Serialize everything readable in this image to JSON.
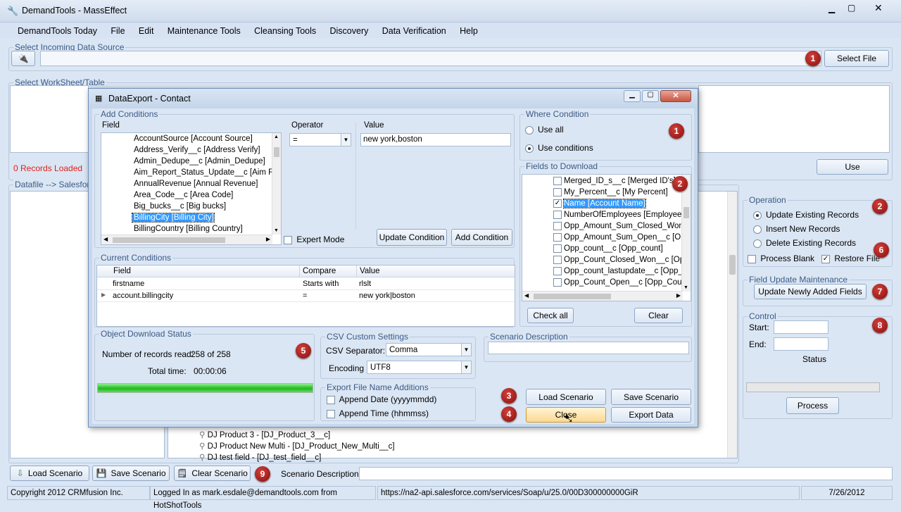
{
  "app": {
    "title": "DemandTools - MassEffect"
  },
  "menu": [
    "DemandTools Today",
    "File",
    "Edit",
    "Maintenance Tools",
    "Cleansing Tools",
    "Discovery",
    "Data Verification",
    "Help"
  ],
  "source": {
    "group_label": "Select Incoming Data Source",
    "select_file": "Select File"
  },
  "worksheet": {
    "group_label": "Select WorkSheet/Table"
  },
  "records_loaded": "0 Records Loaded",
  "use_button": "Use",
  "mapping_label": "Datafile --> Salesforce",
  "operation": {
    "label": "Operation",
    "options": [
      "Update Existing Records",
      "Insert New Records",
      "Delete Existing Records"
    ],
    "process_blank": "Process Blank",
    "restore_file": "Restore File"
  },
  "field_update": {
    "label": "Field Update Maintenance",
    "button": "Update Newly Added Fields"
  },
  "control": {
    "label": "Control",
    "start": "Start:",
    "end": "End:",
    "status": "Status",
    "process": "Process"
  },
  "bg_tree": [
    "DJ Product 3 - [DJ_Product_3__c]",
    "DJ Product New Multi - [DJ_Product_New_Multi__c]",
    "DJ test field - [DJ_test_field__c]"
  ],
  "bottom": {
    "load": "Load Scenario",
    "save": "Save Scenario",
    "clear": "Clear Scenario",
    "desc_label": "Scenario Description:"
  },
  "statusbar": {
    "copyright": "Copyright 2012 CRMfusion Inc.",
    "login": "Logged In as mark.esdale@demandtools.com from HotShotTools",
    "url": "https://na2-api.salesforce.com/services/Soap/u/25.0/00D300000000GiR",
    "date": "7/26/2012"
  },
  "badges": [
    "1",
    "1",
    "2",
    "2",
    "3",
    "4",
    "5",
    "6",
    "7",
    "8",
    "9"
  ],
  "dialog": {
    "title": "DataExport - Contact",
    "add_conditions": "Add Conditions",
    "field_header": "Field",
    "operator_header": "Operator",
    "value_header": "Value",
    "operator_value": "=",
    "value_input": "new york,boston",
    "fields": [
      "AccountSource [Account Source]",
      "Address_Verify__c [Address Verify]",
      "Admin_Dedupe__c [Admin_Dedupe]",
      "Aim_Report_Status_Update__c [Aim Rep",
      "AnnualRevenue [Annual Revenue]",
      "Area_Code__c [Area Code]",
      "Big_bucks__c [Big bucks]",
      "BillingCity [Billing City]",
      "BillingCountry [Billing Country]"
    ],
    "expert_mode": "Expert Mode",
    "update_condition": "Update Condition",
    "add_condition": "Add Condition",
    "where_condition": "Where Condition",
    "use_all": "Use all",
    "use_conditions": "Use conditions",
    "fields_to_download": "Fields to Download",
    "download_fields": [
      "Merged_ID_s__c [Merged ID's]",
      "My_Percent__c [My Percent]",
      "Name [Account Name]",
      "NumberOfEmployees [Employees]",
      "Opp_Amount_Sum_Closed_Won__",
      "Opp_Amount_Sum_Open__c [Opp_",
      "Opp_count__c [Opp_count]",
      "Opp_Count_Closed_Won__c [Opp_",
      "Opp_count_lastupdate__c [Opp_co",
      "Opp_Count_Open__c [Opp_Count_"
    ],
    "check_all": "Check all",
    "clear": "Clear",
    "current_conditions": "Current Conditions",
    "cond_columns": [
      "Field",
      "Compare",
      "Value"
    ],
    "conditions": [
      [
        "firstname",
        "Starts with",
        "rlslt"
      ],
      [
        "account.billingcity",
        "=",
        "new york|boston"
      ]
    ],
    "object_download_status": "Object Download Status",
    "records_read_label": "Number of records read:",
    "records_read": "258 of 258",
    "total_time_label": "Total time:",
    "total_time": "00:00:06",
    "progress": 1.0,
    "csv_settings": "CSV Custom Settings",
    "csv_separator_label": "CSV Separator:",
    "csv_separator": "Comma",
    "encoding_label": "Encoding",
    "encoding": "UTF8",
    "export_additions": "Export File Name Additions",
    "append_date": "Append Date (yyyymmdd)",
    "append_time": "Append Time (hhmmss)",
    "scenario_description": "Scenario Description",
    "load_scenario": "Load Scenario",
    "save_scenario": "Save Scenario",
    "close": "Close",
    "export_data": "Export Data"
  }
}
